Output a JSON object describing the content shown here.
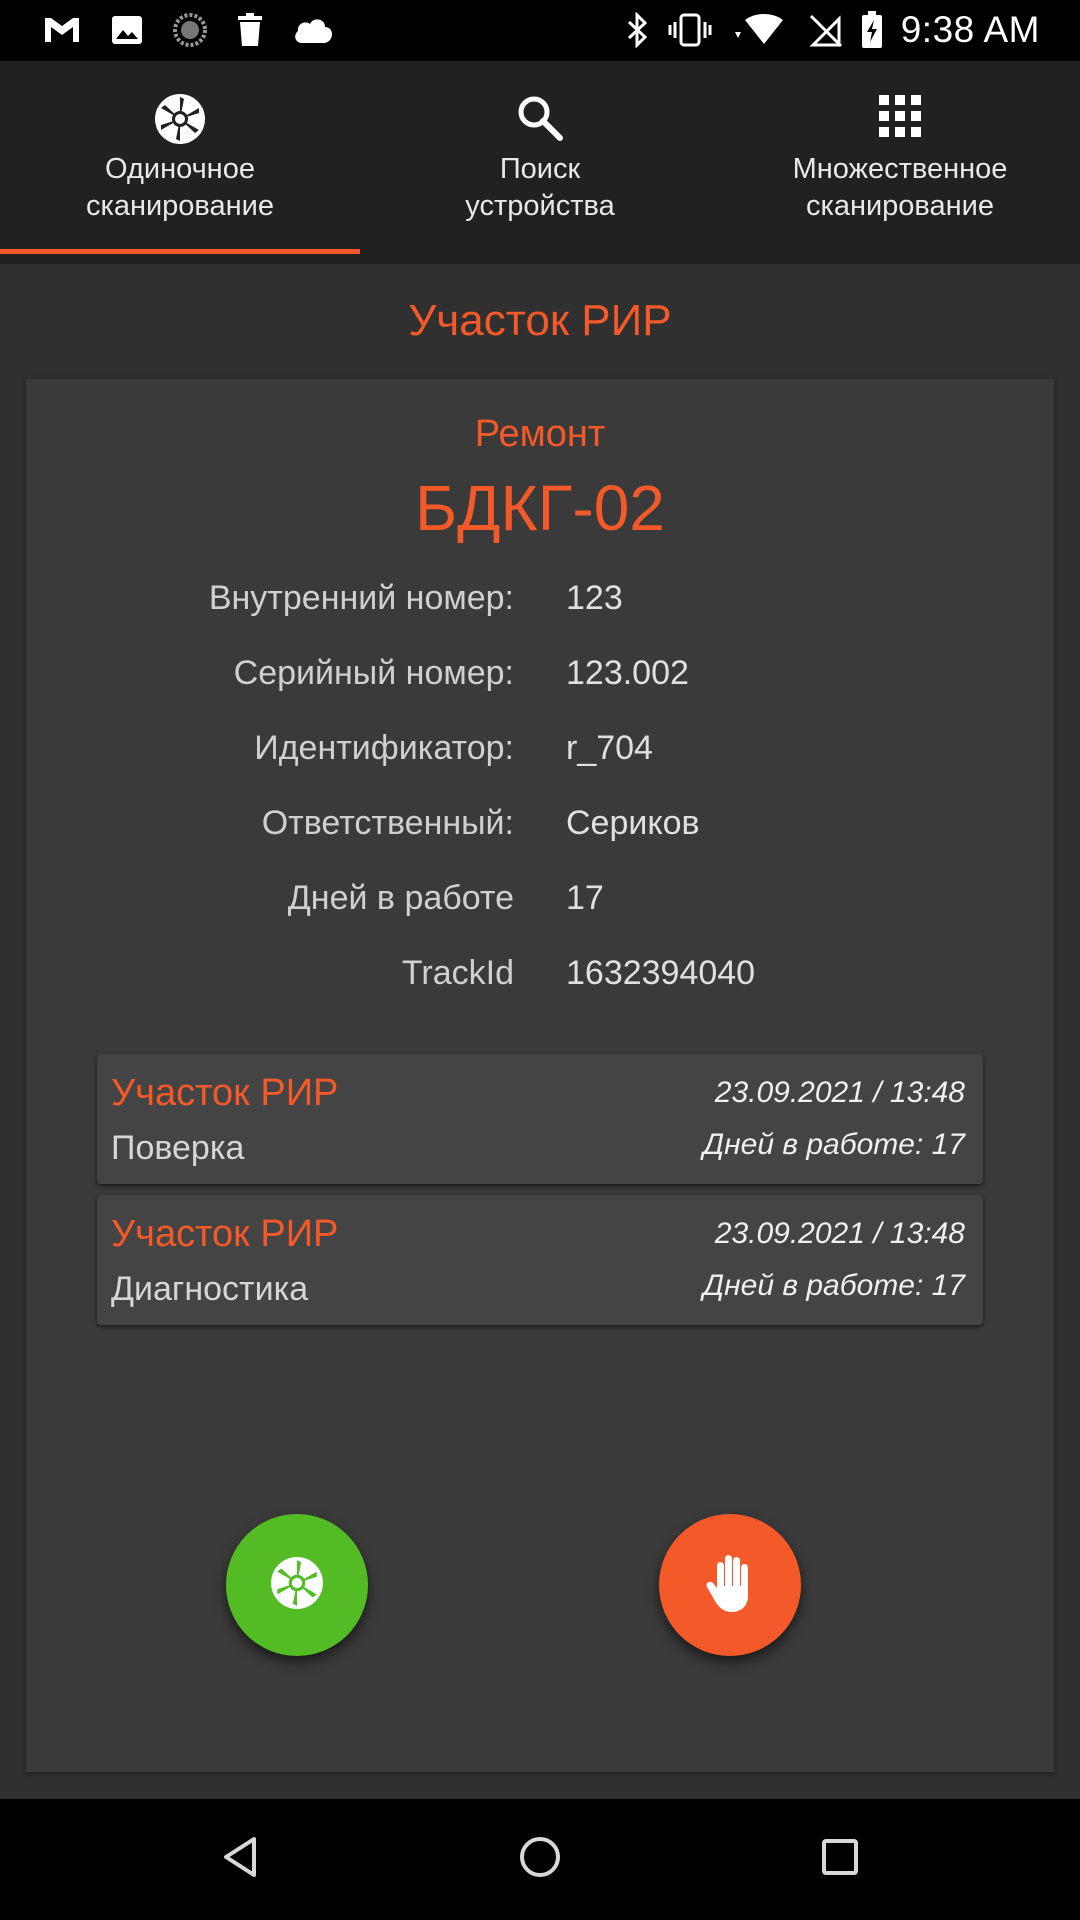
{
  "status_bar": {
    "time": "9:38 AM",
    "left_icons": [
      "gmail-icon",
      "image-icon",
      "sync-progress-icon",
      "trash-icon",
      "cloud-icon"
    ],
    "right_icons": [
      "bluetooth-icon",
      "vibrate-icon",
      "wifi-icon",
      "no-sim-icon",
      "battery-charging-icon"
    ]
  },
  "tabs": [
    {
      "label": "Одиночное\nсканирование",
      "icon": "shutter-icon",
      "active": true
    },
    {
      "label": "Поиск\nустройства",
      "icon": "search-icon",
      "active": false
    },
    {
      "label": "Множественное\nсканирование",
      "icon": "grid-icon",
      "active": false
    }
  ],
  "section_title": "Участок РИР",
  "device": {
    "status": "Ремонт",
    "name": "БДКГ-02",
    "fields": [
      {
        "key": "Внутренний номер:",
        "value": "123"
      },
      {
        "key": "Серийный номер:",
        "value": "123.002"
      },
      {
        "key": "Идентификатор:",
        "value": "r_704"
      },
      {
        "key": "Ответственный:",
        "value": "Сериков"
      },
      {
        "key": "Дней в работе",
        "value": "17"
      },
      {
        "key": "TrackId",
        "value": "1632394040"
      }
    ]
  },
  "history": [
    {
      "area": "Участок РИР",
      "operation": "Поверка",
      "datetime": "23.09.2021 / 13:48",
      "days": "Дней в работе: 17"
    },
    {
      "area": "Участок РИР",
      "operation": "Диагностика",
      "datetime": "23.09.2021 / 13:48",
      "days": "Дней в работе: 17"
    }
  ],
  "actions": {
    "scan_icon": "shutter-icon",
    "stop_icon": "hand-stop-icon"
  },
  "colors": {
    "accent": "#f4592a",
    "scan_button": "#53bb24",
    "stop_button": "#f4592a",
    "background": "#303030",
    "card": "#3a3a3a",
    "tab_bar": "#212121"
  },
  "nav_bar": {
    "buttons": [
      "back-icon",
      "home-icon",
      "recents-icon"
    ]
  }
}
